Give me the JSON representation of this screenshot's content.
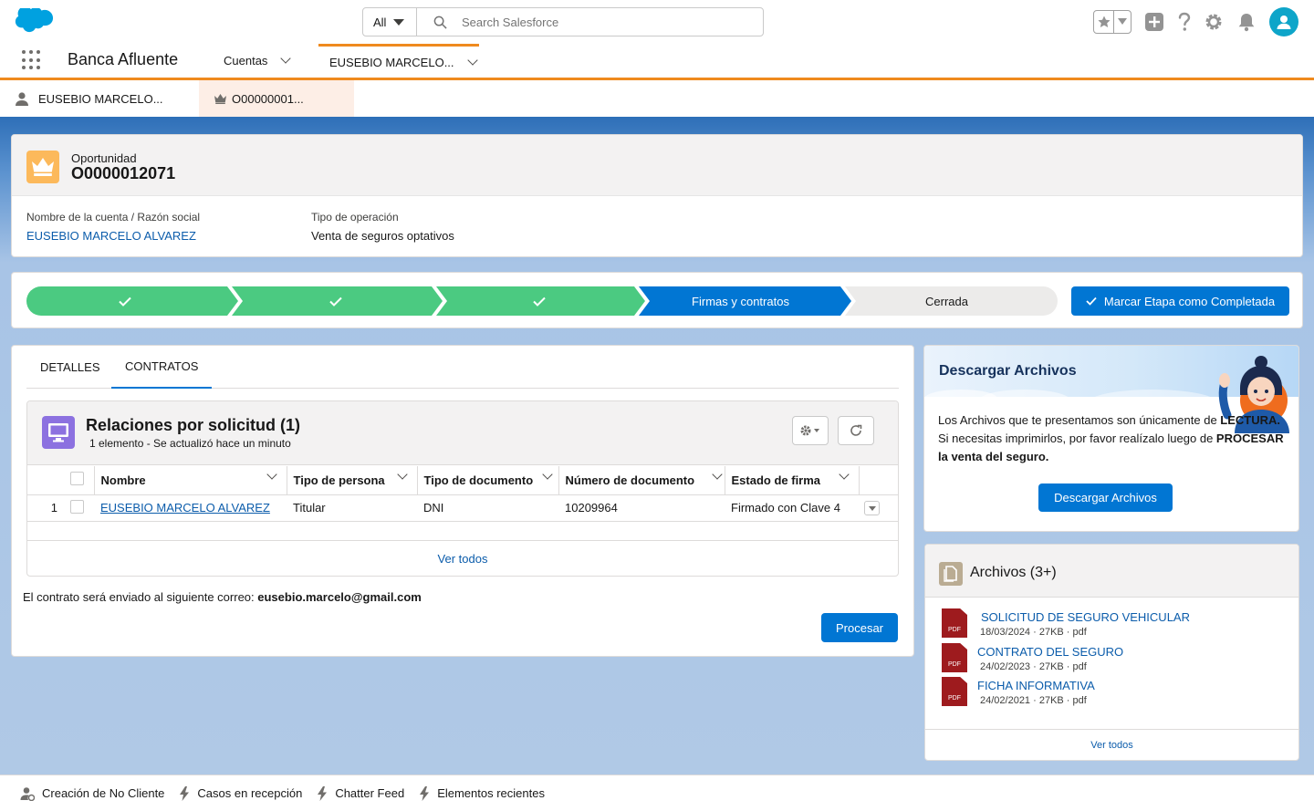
{
  "header": {
    "search_scope": "All",
    "search_placeholder": "Search Salesforce"
  },
  "nav": {
    "app_name": "Banca Afluente",
    "items": [
      {
        "label": "Cuentas"
      },
      {
        "label": "EUSEBIO MARCELO..."
      }
    ]
  },
  "workspace_tabs": [
    {
      "label": "EUSEBIO MARCELO...",
      "icon": "person-icon"
    },
    {
      "label": "O00000001...",
      "icon": "crown-icon"
    }
  ],
  "record": {
    "object_label": "Oportunidad",
    "name": "O0000012071",
    "fields": [
      {
        "label": "Nombre de la cuenta / Razón social",
        "value": "EUSEBIO MARCELO ALVAREZ"
      },
      {
        "label": "Tipo de operación",
        "value": "Venta de seguros optativos"
      }
    ]
  },
  "path": {
    "steps": [
      {
        "label": "",
        "state": "complete"
      },
      {
        "label": "",
        "state": "complete"
      },
      {
        "label": "",
        "state": "complete"
      },
      {
        "label": "Firmas y contratos",
        "state": "current"
      },
      {
        "label": "Cerrada",
        "state": "incomplete"
      }
    ],
    "mark_button": "Marcar Etapa como Completada",
    "colors": {
      "complete": "#4bca81",
      "current": "#0176d3",
      "incomplete": "#ecebea"
    }
  },
  "tabs": [
    {
      "label": "DETALLES",
      "active": false
    },
    {
      "label": "CONTRATOS",
      "active": true
    }
  ],
  "related_list": {
    "title": "Relaciones por solicitud (1)",
    "subtitle": "1 elemento - Se actualizó hace un minuto",
    "columns": [
      "Nombre",
      "Tipo de persona",
      "Tipo de documento",
      "Número de documento",
      "Estado de firma"
    ],
    "rows": [
      {
        "num": "1",
        "nombre": "EUSEBIO MARCELO ALVAREZ",
        "tipo_persona": "Titular",
        "tipo_documento": "DNI",
        "numero_documento": "10209964",
        "estado_firma": "Firmado con Clave 4"
      }
    ],
    "view_all": "Ver todos"
  },
  "contract": {
    "mail_prefix": "El contrato será enviado al siguiente correo: ",
    "mail": "eusebio.marcelo@gmail.com",
    "process_button": "Procesar"
  },
  "download": {
    "title": "Descargar Archivos",
    "text_1": "Los Archivos que te presentamos son únicamente de ",
    "text_bold_1": "LECTURA.",
    "text_2": " Si necesitas imprimirlos, por favor realízalo luego de ",
    "text_bold_2": "PROCESAR la venta del seguro.",
    "button": "Descargar Archivos"
  },
  "files": {
    "title": "Archivos (3+)",
    "items": [
      {
        "name": "SOLICITUD DE SEGURO VEHICULAR",
        "meta": "18/03/2024 · 27KB · pdf",
        "type": "PDF"
      },
      {
        "name": "CONTRATO DEL SEGURO",
        "meta": "24/02/2023 · 27KB · pdf",
        "type": "PDF"
      },
      {
        "name": "FICHA INFORMATIVA",
        "meta": "24/02/2021 · 27KB · pdf",
        "type": "PDF"
      }
    ],
    "view_all": "Ver todos"
  },
  "utility_bar": [
    {
      "label": "Creación de No Cliente",
      "icon": "person-add-icon"
    },
    {
      "label": "Casos en recepción",
      "icon": "lightning-icon"
    },
    {
      "label": "Chatter Feed",
      "icon": "lightning-icon"
    },
    {
      "label": "Elementos recientes",
      "icon": "lightning-icon"
    }
  ]
}
